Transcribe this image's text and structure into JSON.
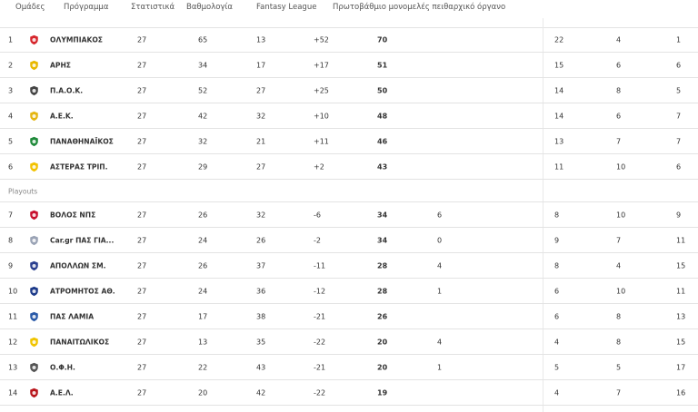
{
  "nav": {
    "teams": "Ομάδες",
    "program": "Πρόγραμμα",
    "stats": "Στατιστικά",
    "standings": "Βαθμολογία",
    "fantasy": "Fantasy League",
    "disciplinary": "Πρωτοβάθμιο μονομελές πειθαρχικό όργανο"
  },
  "playoffs": [
    {
      "pos": "1",
      "team": "ΟΛΥΜΠΙΑΚΟΣ",
      "played": "27",
      "gf": "65",
      "ga": "13",
      "gd": "+52",
      "pts": "70",
      "pen": "",
      "w": "22",
      "d": "4",
      "l": "1",
      "crest_color": "#d6262c",
      "crest": "olympiakos-crest-icon"
    },
    {
      "pos": "2",
      "team": "ΑΡΗΣ",
      "played": "27",
      "gf": "34",
      "ga": "17",
      "gd": "+17",
      "pts": "51",
      "pen": "",
      "w": "15",
      "d": "6",
      "l": "6",
      "crest_color": "#e8b800",
      "crest": "aris-crest-icon"
    },
    {
      "pos": "3",
      "team": "Π.Α.Ο.Κ.",
      "played": "27",
      "gf": "52",
      "ga": "27",
      "gd": "+25",
      "pts": "50",
      "pen": "",
      "w": "14",
      "d": "8",
      "l": "5",
      "crest_color": "#444444",
      "crest": "paok-crest-icon"
    },
    {
      "pos": "4",
      "team": "Α.Ε.Κ.",
      "played": "27",
      "gf": "42",
      "ga": "32",
      "gd": "+10",
      "pts": "48",
      "pen": "",
      "w": "14",
      "d": "6",
      "l": "7",
      "crest_color": "#e5b611",
      "crest": "aek-crest-icon"
    },
    {
      "pos": "5",
      "team": "ΠΑΝΑΘΗΝΑΪΚΟΣ",
      "played": "27",
      "gf": "32",
      "ga": "21",
      "gd": "+11",
      "pts": "46",
      "pen": "",
      "w": "13",
      "d": "7",
      "l": "7",
      "crest_color": "#1f8a3a",
      "crest": "panathinaikos-crest-icon"
    },
    {
      "pos": "6",
      "team": "ΑΣΤΕΡΑΣ ΤΡΙΠ.",
      "played": "27",
      "gf": "29",
      "ga": "27",
      "gd": "+2",
      "pts": "43",
      "pen": "",
      "w": "11",
      "d": "10",
      "l": "6",
      "crest_color": "#f2c200",
      "crest": "asteras-crest-icon"
    }
  ],
  "playouts_label": "Playouts",
  "playouts": [
    {
      "pos": "7",
      "team": "ΒΟΛΟΣ ΝΠΣ",
      "played": "27",
      "gf": "26",
      "ga": "32",
      "gd": "-6",
      "pts": "34",
      "pen": "6",
      "w": "8",
      "d": "10",
      "l": "9",
      "crest_color": "#c8102e",
      "crest": "volos-crest-icon"
    },
    {
      "pos": "8",
      "team": "Car.gr ΠΑΣ ΓΙΑ...",
      "played": "27",
      "gf": "24",
      "ga": "26",
      "gd": "-2",
      "pts": "34",
      "pen": "0",
      "w": "9",
      "d": "7",
      "l": "11",
      "crest_color": "#9aa3b5",
      "crest": "pas-giannina-crest-icon"
    },
    {
      "pos": "9",
      "team": "ΑΠΟΛΛΩΝ ΣΜ.",
      "played": "27",
      "gf": "26",
      "ga": "37",
      "gd": "-11",
      "pts": "28",
      "pen": "4",
      "w": "8",
      "d": "4",
      "l": "15",
      "crest_color": "#2a3f8f",
      "crest": "apollon-crest-icon"
    },
    {
      "pos": "10",
      "team": "ΑΤΡΟΜΗΤΟΣ ΑΘ.",
      "played": "27",
      "gf": "24",
      "ga": "36",
      "gd": "-12",
      "pts": "28",
      "pen": "1",
      "w": "6",
      "d": "10",
      "l": "11",
      "crest_color": "#1d3b8a",
      "crest": "atromitos-crest-icon"
    },
    {
      "pos": "11",
      "team": "ΠΑΣ ΛΑΜΙΑ",
      "played": "27",
      "gf": "17",
      "ga": "38",
      "gd": "-21",
      "pts": "26",
      "pen": "",
      "w": "6",
      "d": "8",
      "l": "13",
      "crest_color": "#2a5aa8",
      "crest": "lamia-crest-icon"
    },
    {
      "pos": "12",
      "team": "ΠΑΝΑΙΤΩΛΙΚΟΣ",
      "played": "27",
      "gf": "13",
      "ga": "35",
      "gd": "-22",
      "pts": "20",
      "pen": "4",
      "w": "4",
      "d": "8",
      "l": "15",
      "crest_color": "#f0c400",
      "crest": "panaitolikos-crest-icon"
    },
    {
      "pos": "13",
      "team": "Ο.Φ.Η.",
      "played": "27",
      "gf": "22",
      "ga": "43",
      "gd": "-21",
      "pts": "20",
      "pen": "1",
      "w": "5",
      "d": "5",
      "l": "17",
      "crest_color": "#555555",
      "crest": "ofi-crest-icon"
    },
    {
      "pos": "14",
      "team": "Α.Ε.Λ.",
      "played": "27",
      "gf": "20",
      "ga": "42",
      "gd": "-22",
      "pts": "19",
      "pen": "",
      "w": "4",
      "d": "7",
      "l": "16",
      "crest_color": "#b8151b",
      "crest": "ael-crest-icon"
    }
  ]
}
